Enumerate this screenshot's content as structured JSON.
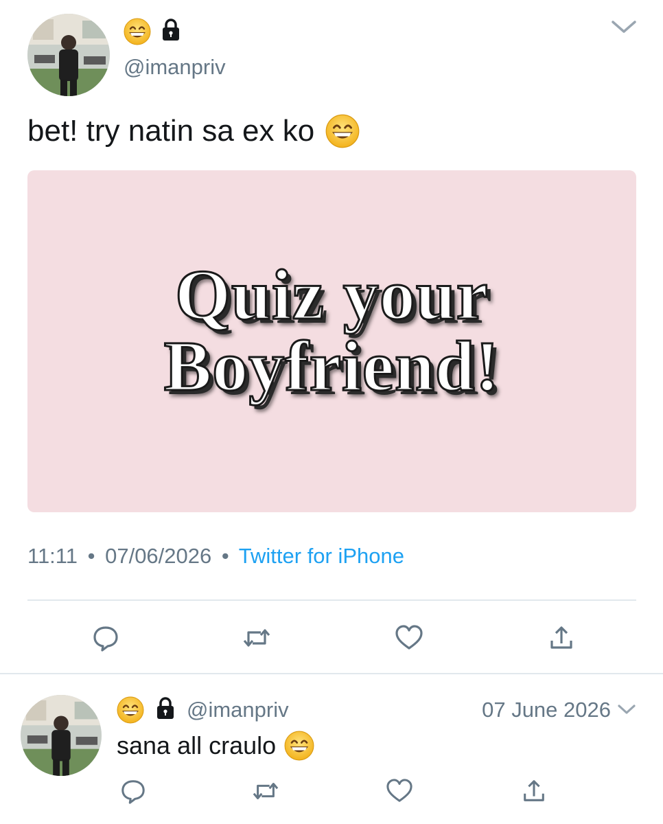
{
  "tweet": {
    "handle": "@imanpriv",
    "text": "bet! try natin sa ex ko",
    "card": {
      "line1": "Quiz your",
      "line2": "Boyfriend!"
    },
    "time": "11:11",
    "date": "07/06/2026",
    "source": "Twitter for iPhone",
    "separator": "•"
  },
  "reply": {
    "handle": "@imanpriv",
    "date": "07 June 2026",
    "text": "sana all craulo"
  },
  "icons": {
    "name_emoji": "grinning-face-icon",
    "lock": "lock-icon",
    "caret": "chevron-down-icon",
    "reply": "reply-icon",
    "retweet": "retweet-icon",
    "like": "heart-icon",
    "share": "share-icon"
  },
  "colors": {
    "link": "#1da1f2",
    "secondary_text": "#657786",
    "card_background": "#f4dde1",
    "icon": "#657786"
  }
}
